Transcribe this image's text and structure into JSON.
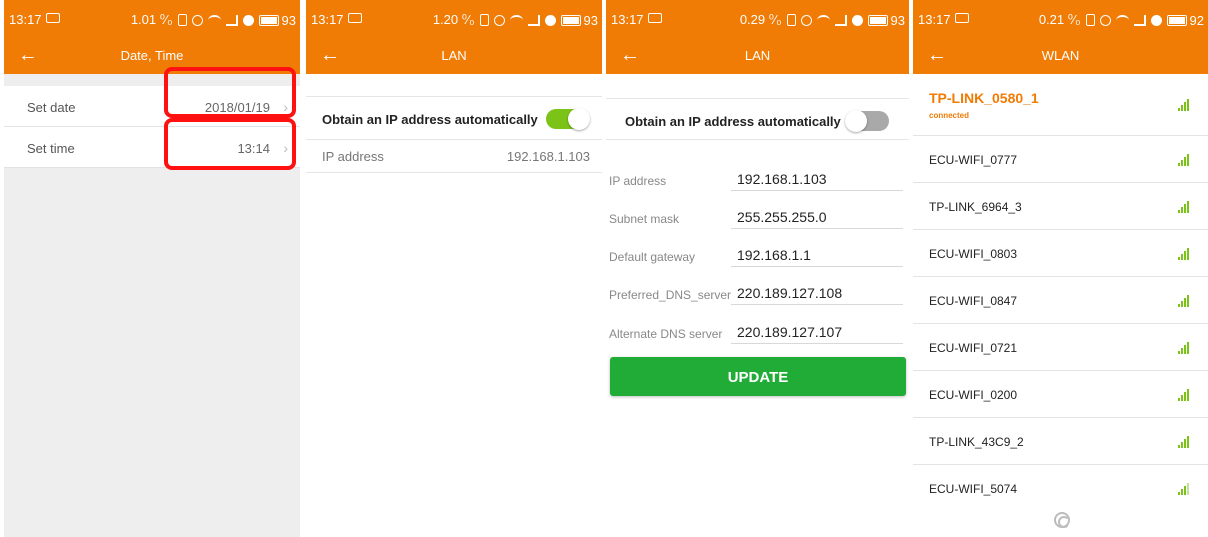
{
  "screens": [
    {
      "status": {
        "time": "13:17",
        "rate": "1.01 ⁰⁄₀",
        "battery": "93"
      },
      "title": "Date, Time",
      "rows": [
        {
          "label": "Set date",
          "value": "2018/01/19"
        },
        {
          "label": "Set time",
          "value": "13:14"
        }
      ]
    },
    {
      "status": {
        "time": "13:17",
        "rate": "1.20 ⁰⁄₀",
        "battery": "93"
      },
      "title": "LAN",
      "auto_label": "Obtain an IP address automatically",
      "auto_on": true,
      "ip_label": "IP address",
      "ip_value": "192.168.1.103"
    },
    {
      "status": {
        "time": "13:17",
        "rate": "0.29 ⁰⁄₀",
        "battery": "93"
      },
      "title": "LAN",
      "auto_label": "Obtain an IP address automatically",
      "auto_on": false,
      "fields": [
        {
          "label": "IP address",
          "value": "192.168.1.103"
        },
        {
          "label": "Subnet mask",
          "value": "255.255.255.0"
        },
        {
          "label": "Default gateway",
          "value": "192.168.1.1"
        },
        {
          "label": "Preferred_DNS_server",
          "value": "220.189.127.108"
        },
        {
          "label": "Alternate DNS server",
          "value": "220.189.127.107"
        }
      ],
      "update_label": "UPDATE"
    },
    {
      "status": {
        "time": "13:17",
        "rate": "0.21 ⁰⁄₀",
        "battery": "92"
      },
      "title": "WLAN",
      "networks": [
        {
          "name": "TP-LINK_0580_1",
          "status": "connected"
        },
        {
          "name": "ECU-WIFI_0777"
        },
        {
          "name": "TP-LINK_6964_3"
        },
        {
          "name": "ECU-WIFI_0803"
        },
        {
          "name": "ECU-WIFI_0847"
        },
        {
          "name": "ECU-WIFI_0721"
        },
        {
          "name": "ECU-WIFI_0200"
        },
        {
          "name": "TP-LINK_43C9_2"
        },
        {
          "name": "ECU-WIFI_5074"
        }
      ]
    }
  ],
  "colors": {
    "accent": "#f07b05",
    "toggle_on": "#7bc417",
    "toggle_off": "#a9a9a9",
    "update_button": "#21ac38",
    "highlight": "#ff1111"
  },
  "icons": {
    "back": "arrow-left-icon",
    "signal": "wifi-signal-icon",
    "loading": "loading-spinner-icon"
  }
}
